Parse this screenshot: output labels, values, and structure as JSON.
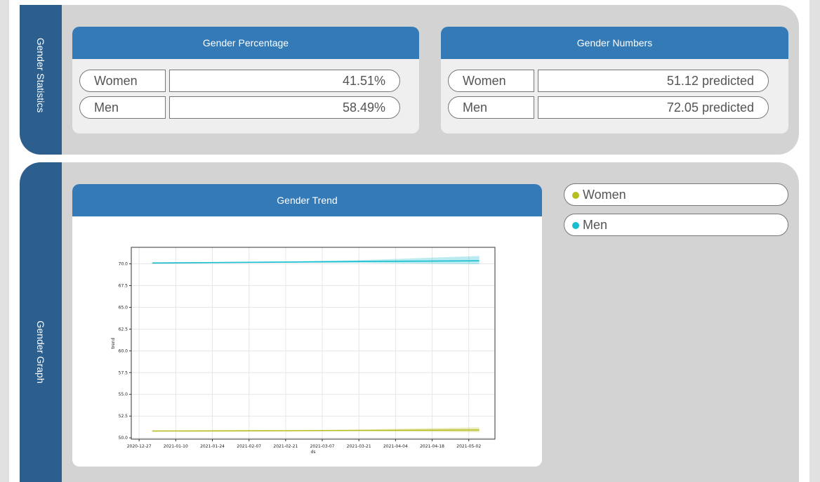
{
  "stats": {
    "side_label": "Gender Statistics",
    "percentage": {
      "title": "Gender Percentage",
      "rows": [
        {
          "label": "Women",
          "value": "41.51%"
        },
        {
          "label": "Men",
          "value": "58.49%"
        }
      ]
    },
    "numbers": {
      "title": "Gender Numbers",
      "rows": [
        {
          "label": "Women",
          "value": "51.12 predicted"
        },
        {
          "label": "Men",
          "value": "72.05 predicted"
        }
      ]
    }
  },
  "graph": {
    "side_label": "Gender Graph",
    "title": "Gender Trend",
    "legend": [
      {
        "label": "Women",
        "color": "#b5bd1f"
      },
      {
        "label": "Men",
        "color": "#17becf"
      }
    ]
  },
  "chart_data": {
    "type": "line",
    "title": "",
    "xlabel": "ds",
    "ylabel": "trend",
    "x_ticks": [
      "2020-12-27",
      "2021-01-10",
      "2021-01-24",
      "2021-02-07",
      "2021-02-21",
      "2021-03-07",
      "2021-03-21",
      "2021-04-04",
      "2021-04-18",
      "2021-05-02"
    ],
    "y_ticks": [
      "50.0",
      "52.5",
      "55.0",
      "57.5",
      "60.0",
      "62.5",
      "65.0",
      "67.5",
      "70.0"
    ],
    "xlim": [
      "2020-12-24",
      "2021-05-12"
    ],
    "ylim": [
      49.85,
      71.9
    ],
    "grid": true,
    "series": [
      {
        "name": "Men",
        "color": "#17becf",
        "points": [
          {
            "x": "2021-01-01",
            "y": 70.1,
            "lower": 70.05,
            "upper": 70.15
          },
          {
            "x": "2021-02-21",
            "y": 70.2,
            "lower": 70.15,
            "upper": 70.28
          },
          {
            "x": "2021-03-21",
            "y": 70.27,
            "lower": 70.12,
            "upper": 70.42
          },
          {
            "x": "2021-05-06",
            "y": 70.35,
            "lower": 69.95,
            "upper": 70.9
          }
        ]
      },
      {
        "name": "Women",
        "color": "#b5bd1f",
        "points": [
          {
            "x": "2021-01-01",
            "y": 50.78,
            "lower": 50.75,
            "upper": 50.82
          },
          {
            "x": "2021-02-21",
            "y": 50.82,
            "lower": 50.78,
            "upper": 50.86
          },
          {
            "x": "2021-03-21",
            "y": 50.85,
            "lower": 50.78,
            "upper": 50.95
          },
          {
            "x": "2021-05-06",
            "y": 50.9,
            "lower": 50.65,
            "upper": 51.2
          }
        ]
      }
    ]
  }
}
